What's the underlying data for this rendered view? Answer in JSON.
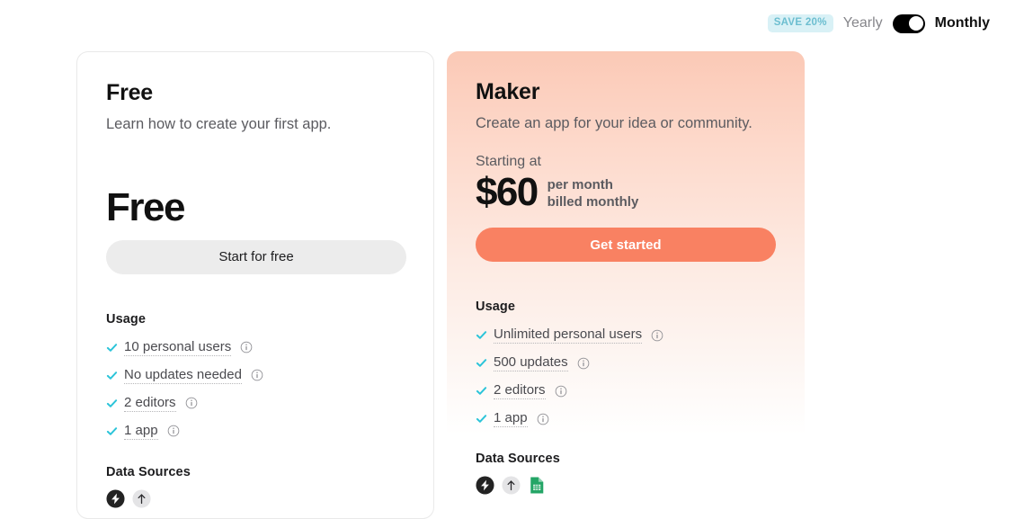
{
  "billing_toggle": {
    "save_badge": "SAVE 20%",
    "yearly_label": "Yearly",
    "monthly_label": "Monthly",
    "selected": "Monthly",
    "badge_bg": "#d9f1f6",
    "badge_text_color": "#6cbed0",
    "switch_color": "#000000"
  },
  "plans": [
    {
      "name": "Free",
      "description": "Learn how to create your first app.",
      "price_display": "Free",
      "cta_label": "Start for free",
      "cta_bg": "#ececec",
      "cta_text_color": "#1d1d1f",
      "usage_title": "Usage",
      "usage": [
        {
          "label": "10 personal users",
          "info": "info-icon"
        },
        {
          "label": "No updates needed",
          "info": "info-icon"
        },
        {
          "label": "2 editors",
          "info": "info-icon"
        },
        {
          "label": "1 app",
          "info": "info-icon"
        }
      ],
      "data_sources_title": "Data Sources",
      "data_sources": [
        {
          "name": "glide-tables-icon",
          "color": "#232323"
        },
        {
          "name": "upload-arrow-icon",
          "color": "#e4e4e6"
        }
      ]
    },
    {
      "name": "Maker",
      "description": "Create an app for your idea or community.",
      "starting_at_label": "Starting at",
      "price_display": "$60",
      "price_period": "per month",
      "price_billing": "billed monthly",
      "cta_label": "Get started",
      "cta_bg": "#f98162",
      "cta_text_color": "#ffffff",
      "usage_title": "Usage",
      "usage": [
        {
          "label": "Unlimited personal users",
          "info": "info-icon"
        },
        {
          "label": "500 updates",
          "info": "info-icon"
        },
        {
          "label": "2 editors",
          "info": "info-icon"
        },
        {
          "label": "1 app",
          "info": "info-icon"
        }
      ],
      "data_sources_title": "Data Sources",
      "data_sources": [
        {
          "name": "glide-tables-icon",
          "color": "#232323"
        },
        {
          "name": "upload-arrow-icon",
          "color": "#e4e4e6"
        },
        {
          "name": "google-sheets-icon",
          "color": "#23a566"
        }
      ]
    }
  ],
  "theme": {
    "check_color": "#2bc4d9",
    "card_border": "#e9e9e9",
    "maker_gradient_top": "#fbc9b6"
  }
}
